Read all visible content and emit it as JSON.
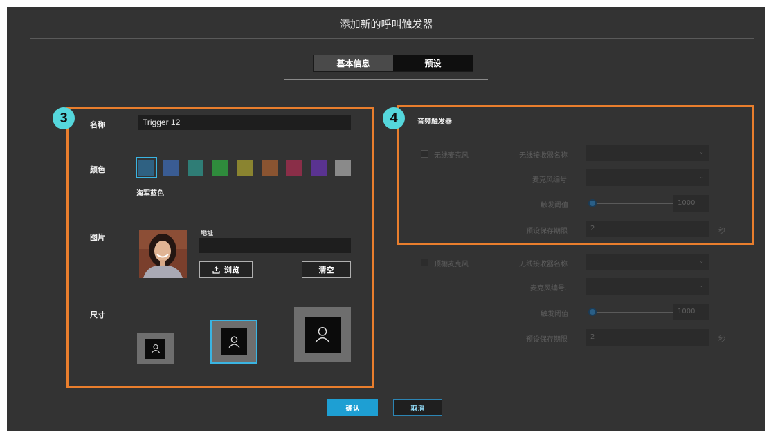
{
  "dialog": {
    "title": "添加新的呼叫触发器"
  },
  "tabs": [
    {
      "label": "基本信息",
      "active": true
    },
    {
      "label": "预设",
      "active": false
    }
  ],
  "badges": {
    "left": "3",
    "right": "4"
  },
  "basic": {
    "name_label": "名称",
    "name_value": "Trigger 12",
    "color_label": "颜色",
    "colors": [
      "#2f6182",
      "#3a5c93",
      "#2f7d76",
      "#2f8b3c",
      "#8a8430",
      "#8a5431",
      "#8a2e48",
      "#5a3391",
      "#8a8a8a"
    ],
    "selected_color_index": 0,
    "selected_color_name": "海军蓝色",
    "image_label": "图片",
    "address_label": "地址",
    "address_value": "",
    "browse_icon": "upload-icon",
    "browse_label": "浏览",
    "clear_label": "清空",
    "size_label": "尺寸",
    "sizes": [
      "small",
      "medium",
      "large"
    ],
    "selected_size": "medium"
  },
  "audio": {
    "section_title": "音频触发器",
    "groups": [
      {
        "checkbox_label": "无线麦克风",
        "receiver_label": "无线接收器名称",
        "receiver_value": "",
        "mic_label": "麦克风编号",
        "mic_value": "",
        "threshold_label": "触发阈值",
        "threshold_value": "1000",
        "hold_label": "预设保存期限",
        "hold_value": "2",
        "hold_unit": "秒"
      },
      {
        "checkbox_label": "顶棚麦克风",
        "receiver_label": "无线接收器名称",
        "receiver_value": "",
        "mic_label": "麦克风编号.",
        "mic_value": "",
        "threshold_label": "触发阈值",
        "threshold_value": "1000",
        "hold_label": "预设保存期限",
        "hold_value": "2",
        "hold_unit": "秒"
      }
    ]
  },
  "footer": {
    "confirm_label": "确认",
    "cancel_label": "取消"
  }
}
